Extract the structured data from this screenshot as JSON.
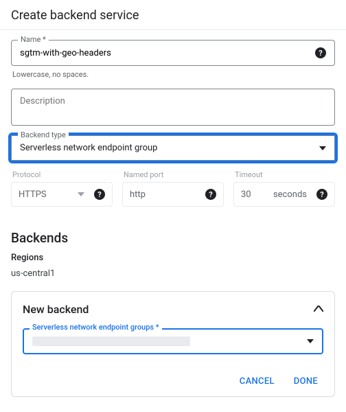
{
  "header": {
    "title": "Create backend service"
  },
  "name_field": {
    "label": "Name *",
    "value": "sgtm-with-geo-headers",
    "helper": "Lowercase, no spaces."
  },
  "description_field": {
    "placeholder": "Description"
  },
  "backend_type_field": {
    "label": "Backend type",
    "value": "Serverless network endpoint group"
  },
  "disabled_row": {
    "protocol": {
      "label": "Protocol",
      "value": "HTTPS"
    },
    "named_port": {
      "label": "Named port",
      "value": "http"
    },
    "timeout": {
      "label": "Timeout",
      "value": "30",
      "unit": "seconds"
    }
  },
  "backends": {
    "heading": "Backends",
    "regions_label": "Regions",
    "region_value": "us-central1"
  },
  "new_backend": {
    "title": "New backend",
    "neg_label": "Serverless network endpoint groups *",
    "cancel": "CANCEL",
    "done": "DONE"
  }
}
